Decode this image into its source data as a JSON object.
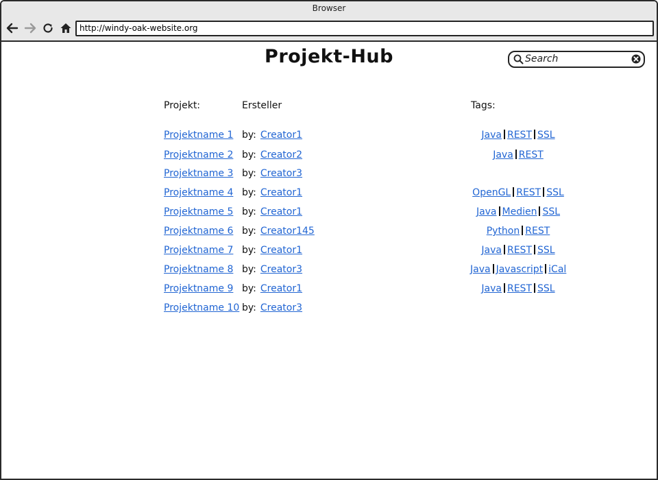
{
  "window": {
    "title": "Browser"
  },
  "toolbar": {
    "url": "http://windy-oak-website.org"
  },
  "page": {
    "title": "Projekt-Hub"
  },
  "search": {
    "placeholder": "Search"
  },
  "table": {
    "headers": {
      "project": "Projekt:",
      "creator": "Ersteller",
      "tags": "Tags:"
    },
    "by_label": "by:",
    "rows": [
      {
        "project": "Projektname 1",
        "creator": "Creator1",
        "tags": [
          "Java",
          "REST",
          "SSL"
        ]
      },
      {
        "project": "Projektname 2",
        "creator": "Creator2",
        "tags": [
          "Java",
          "REST"
        ]
      },
      {
        "project": "Projektname 3",
        "creator": "Creator3",
        "tags": []
      },
      {
        "project": "Projektname 4",
        "creator": "Creator1",
        "tags": [
          "OpenGL",
          "REST",
          "SSL"
        ]
      },
      {
        "project": "Projektname 5",
        "creator": "Creator1",
        "tags": [
          "Java",
          "Medien",
          "SSL"
        ]
      },
      {
        "project": "Projektname 6",
        "creator": "Creator145",
        "tags": [
          "Python",
          "REST"
        ]
      },
      {
        "project": "Projektname 7",
        "creator": "Creator1",
        "tags": [
          "Java",
          "REST",
          "SSL"
        ]
      },
      {
        "project": "Projektname 8",
        "creator": "Creator3",
        "tags": [
          "Java",
          "Javascript",
          "iCal"
        ]
      },
      {
        "project": "Projektname 9",
        "creator": "Creator1",
        "tags": [
          "Java",
          "REST",
          "SSL"
        ]
      },
      {
        "project": "Projektname 10",
        "creator": "Creator3",
        "tags": []
      }
    ]
  },
  "icons": {
    "back": "arrow-left-icon",
    "forward": "arrow-right-icon",
    "reload": "reload-icon",
    "home": "home-icon",
    "search": "search-icon",
    "clear": "clear-icon"
  },
  "colors": {
    "link": "#2165d3",
    "chrome": "#e8e8e8"
  }
}
